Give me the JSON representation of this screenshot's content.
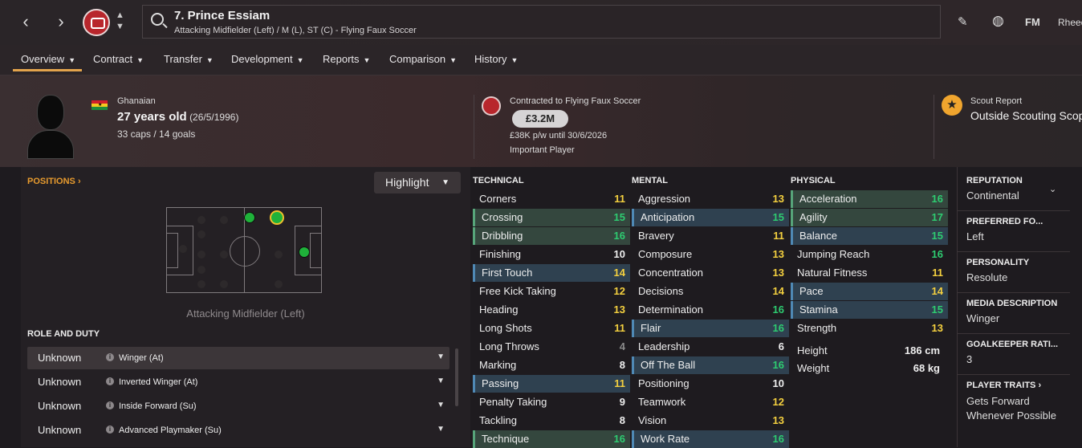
{
  "header": {
    "player_title": "7. Prince Essiam",
    "player_positions": "Attacking Midfielder (Left) / M (L), ST (C) - Flying Faux Soccer",
    "fm_label": "FM",
    "user_name": "Rheed"
  },
  "tabs": [
    {
      "label": "Overview"
    },
    {
      "label": "Contract"
    },
    {
      "label": "Transfer"
    },
    {
      "label": "Development"
    },
    {
      "label": "Reports"
    },
    {
      "label": "Comparison"
    },
    {
      "label": "History"
    }
  ],
  "hero": {
    "nationality": "Ghanaian",
    "age": "27 years old",
    "dob": "(26/5/1996)",
    "caps": "33 caps / 14 goals",
    "contract_label": "Contracted to Flying Faux Soccer",
    "value": "£3.2M",
    "wage": "£38K p/w until 30/6/2026",
    "squad_status": "Important Player",
    "scout_label": "Scout Report",
    "scout_value": "Outside Scouting Scope"
  },
  "positions": {
    "label": "POSITIONS",
    "highlight_label": "Highlight",
    "caption": "Attacking Midfielder (Left)"
  },
  "role_duty": {
    "label": "ROLE AND DUTY",
    "rows": [
      {
        "rating": "Unknown",
        "role": "Winger (At)"
      },
      {
        "rating": "Unknown",
        "role": "Inverted Winger (At)"
      },
      {
        "rating": "Unknown",
        "role": "Inside Forward (Su)"
      },
      {
        "rating": "Unknown",
        "role": "Advanced Playmaker (Su)"
      }
    ]
  },
  "technical": {
    "label": "TECHNICAL",
    "attrs": [
      {
        "name": "Corners",
        "value": "11",
        "hl": ""
      },
      {
        "name": "Crossing",
        "value": "15",
        "hl": "green"
      },
      {
        "name": "Dribbling",
        "value": "16",
        "hl": "green"
      },
      {
        "name": "Finishing",
        "value": "10",
        "hl": ""
      },
      {
        "name": "First Touch",
        "value": "14",
        "hl": "blue"
      },
      {
        "name": "Free Kick Taking",
        "value": "12",
        "hl": ""
      },
      {
        "name": "Heading",
        "value": "13",
        "hl": ""
      },
      {
        "name": "Long Shots",
        "value": "11",
        "hl": ""
      },
      {
        "name": "Long Throws",
        "value": "4",
        "hl": ""
      },
      {
        "name": "Marking",
        "value": "8",
        "hl": ""
      },
      {
        "name": "Passing",
        "value": "11",
        "hl": "blue"
      },
      {
        "name": "Penalty Taking",
        "value": "9",
        "hl": ""
      },
      {
        "name": "Tackling",
        "value": "8",
        "hl": ""
      },
      {
        "name": "Technique",
        "value": "16",
        "hl": "green"
      }
    ]
  },
  "mental": {
    "label": "MENTAL",
    "attrs": [
      {
        "name": "Aggression",
        "value": "13",
        "hl": ""
      },
      {
        "name": "Anticipation",
        "value": "15",
        "hl": "blue"
      },
      {
        "name": "Bravery",
        "value": "11",
        "hl": ""
      },
      {
        "name": "Composure",
        "value": "13",
        "hl": ""
      },
      {
        "name": "Concentration",
        "value": "13",
        "hl": ""
      },
      {
        "name": "Decisions",
        "value": "14",
        "hl": ""
      },
      {
        "name": "Determination",
        "value": "16",
        "hl": ""
      },
      {
        "name": "Flair",
        "value": "16",
        "hl": "blue"
      },
      {
        "name": "Leadership",
        "value": "6",
        "hl": ""
      },
      {
        "name": "Off The Ball",
        "value": "16",
        "hl": "blue"
      },
      {
        "name": "Positioning",
        "value": "10",
        "hl": ""
      },
      {
        "name": "Teamwork",
        "value": "12",
        "hl": ""
      },
      {
        "name": "Vision",
        "value": "13",
        "hl": ""
      },
      {
        "name": "Work Rate",
        "value": "16",
        "hl": "blue"
      }
    ]
  },
  "physical": {
    "label": "PHYSICAL",
    "attrs": [
      {
        "name": "Acceleration",
        "value": "16",
        "hl": "green"
      },
      {
        "name": "Agility",
        "value": "17",
        "hl": "green"
      },
      {
        "name": "Balance",
        "value": "15",
        "hl": "blue"
      },
      {
        "name": "Jumping Reach",
        "value": "16",
        "hl": ""
      },
      {
        "name": "Natural Fitness",
        "value": "11",
        "hl": ""
      },
      {
        "name": "Pace",
        "value": "14",
        "hl": "blue"
      },
      {
        "name": "Stamina",
        "value": "15",
        "hl": "blue"
      },
      {
        "name": "Strength",
        "value": "13",
        "hl": ""
      }
    ],
    "height_label": "Height",
    "height_value": "186 cm",
    "weight_label": "Weight",
    "weight_value": "68 kg"
  },
  "info": [
    {
      "label": "REPUTATION",
      "value": "Continental"
    },
    {
      "label": "PREFERRED FO...",
      "value": "Left"
    },
    {
      "label": "PERSONALITY",
      "value": "Resolute"
    },
    {
      "label": "MEDIA DESCRIPTION",
      "value": "Winger"
    },
    {
      "label": "GOALKEEPER RATI...",
      "value": "3"
    },
    {
      "label": "PLAYER TRAITS",
      "value": "Gets Forward Whenever Possible"
    }
  ],
  "colors": {
    "accent": "#e3a44c",
    "val_green": "#2ecc71",
    "val_yellow": "#f4d03f",
    "val_white": "#eeeeee",
    "val_grey": "#8a8a8a"
  }
}
